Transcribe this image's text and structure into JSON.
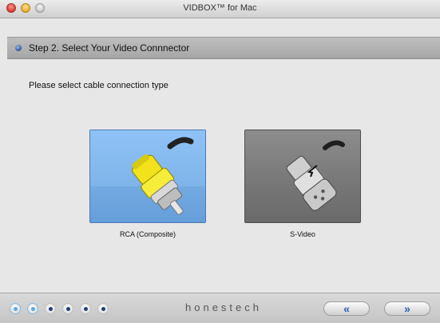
{
  "window": {
    "title": "VIDBOX™ for Mac"
  },
  "step": {
    "label": "Step 2. Select Your Video Connnector"
  },
  "prompt": "Please select cable connection type",
  "options": [
    {
      "label": "RCA (Composite)",
      "selected": true
    },
    {
      "label": "S-Video",
      "selected": false
    }
  ],
  "progress": {
    "total_steps": 6,
    "current_steps_highlighted": 2
  },
  "brand": "honestech",
  "nav": {
    "back_label": "«",
    "next_label": "»"
  },
  "colors": {
    "selected_card": "#8fc3f7",
    "unselected_card": "#7a7a7a",
    "accent": "#2b5fb4"
  }
}
